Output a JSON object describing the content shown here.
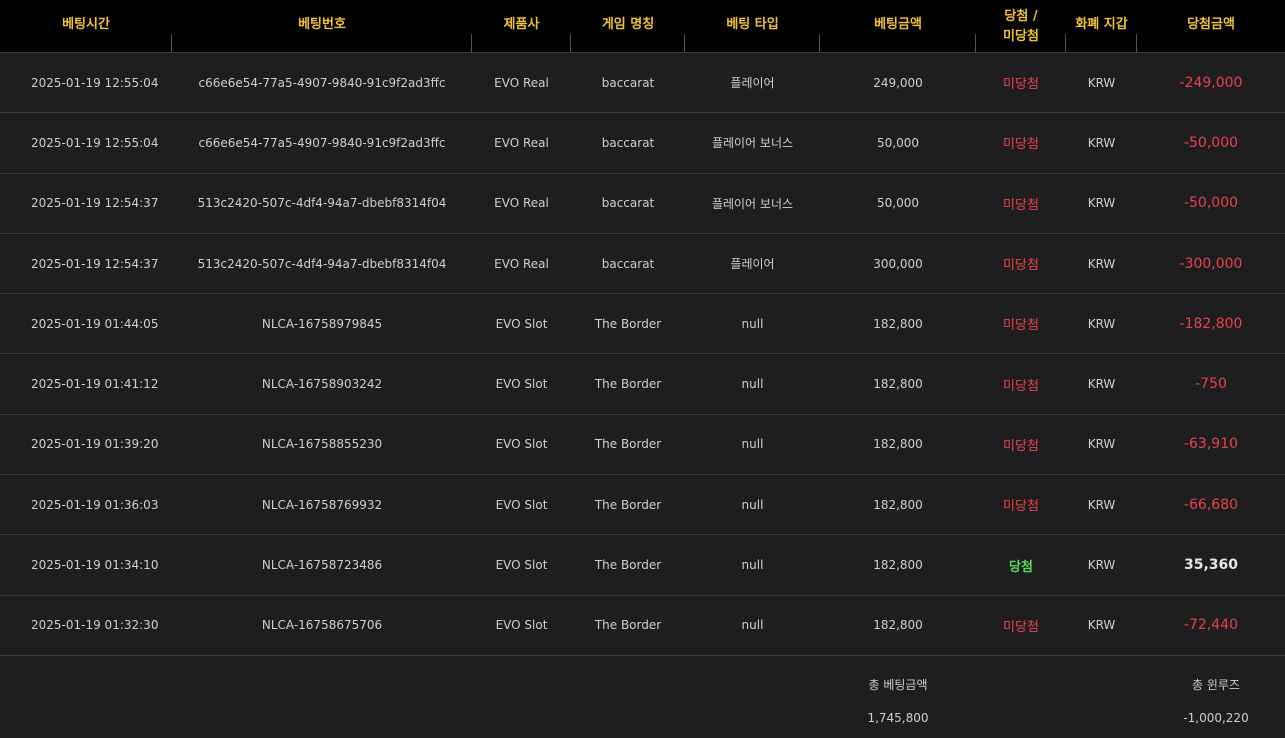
{
  "headers": [
    "베팅시간",
    "베팅번호",
    "제품사",
    "게임 명칭",
    "베팅 타입",
    "베팅금액",
    "당첨 /\n미당첨",
    "화폐 지갑",
    "당첨금액"
  ],
  "rows": [
    {
      "time": "2025-01-19 12:55:04",
      "bet_id": "c66e6e54-77a5-4907-9840-91c9f2ad3ffc",
      "provider": "EVO Real",
      "game": "baccarat",
      "bet_type": "플레이어",
      "amount": "249,000",
      "result": "미당첨",
      "currency": "KRW",
      "payout": "-249,000"
    },
    {
      "time": "2025-01-19 12:55:04",
      "bet_id": "c66e6e54-77a5-4907-9840-91c9f2ad3ffc",
      "provider": "EVO Real",
      "game": "baccarat",
      "bet_type": "플레이어 보너스",
      "amount": "50,000",
      "result": "미당첨",
      "currency": "KRW",
      "payout": "-50,000"
    },
    {
      "time": "2025-01-19 12:54:37",
      "bet_id": "513c2420-507c-4df4-94a7-dbebf8314f04",
      "provider": "EVO Real",
      "game": "baccarat",
      "bet_type": "플레이어 보너스",
      "amount": "50,000",
      "result": "미당첨",
      "currency": "KRW",
      "payout": "-50,000"
    },
    {
      "time": "2025-01-19 12:54:37",
      "bet_id": "513c2420-507c-4df4-94a7-dbebf8314f04",
      "provider": "EVO Real",
      "game": "baccarat",
      "bet_type": "플레이어",
      "amount": "300,000",
      "result": "미당첨",
      "currency": "KRW",
      "payout": "-300,000"
    },
    {
      "time": "2025-01-19 01:44:05",
      "bet_id": "NLCA-16758979845",
      "provider": "EVO Slot",
      "game": "The Border",
      "bet_type": "null",
      "amount": "182,800",
      "result": "미당첨",
      "currency": "KRW",
      "payout": "-182,800"
    },
    {
      "time": "2025-01-19 01:41:12",
      "bet_id": "NLCA-16758903242",
      "provider": "EVO Slot",
      "game": "The Border",
      "bet_type": "null",
      "amount": "182,800",
      "result": "미당첨",
      "currency": "KRW",
      "payout": "-750"
    },
    {
      "time": "2025-01-19 01:39:20",
      "bet_id": "NLCA-16758855230",
      "provider": "EVO Slot",
      "game": "The Border",
      "bet_type": "null",
      "amount": "182,800",
      "result": "미당첨",
      "currency": "KRW",
      "payout": "-63,910"
    },
    {
      "time": "2025-01-19 01:36:03",
      "bet_id": "NLCA-16758769932",
      "provider": "EVO Slot",
      "game": "The Border",
      "bet_type": "null",
      "amount": "182,800",
      "result": "미당첨",
      "currency": "KRW",
      "payout": "-66,680"
    },
    {
      "time": "2025-01-19 01:34:10",
      "bet_id": "NLCA-16758723486",
      "provider": "EVO Slot",
      "game": "The Border",
      "bet_type": "null",
      "amount": "182,800",
      "result": "당첨",
      "currency": "KRW",
      "payout": "35,360"
    },
    {
      "time": "2025-01-19 01:32:30",
      "bet_id": "NLCA-16758675706",
      "provider": "EVO Slot",
      "game": "The Border",
      "bet_type": "null",
      "amount": "182,800",
      "result": "미당첨",
      "currency": "KRW",
      "payout": "-72,440"
    }
  ],
  "summary": {
    "total_bet_label": "총 베팅금액",
    "total_bet_value": "1,745,800",
    "total_winloss_label": "총 윈루즈",
    "total_winloss_value": "-1,000,220"
  },
  "colors": {
    "header_text": "#f1c232",
    "loss": "#e8424d",
    "win": "#5cd65c"
  }
}
